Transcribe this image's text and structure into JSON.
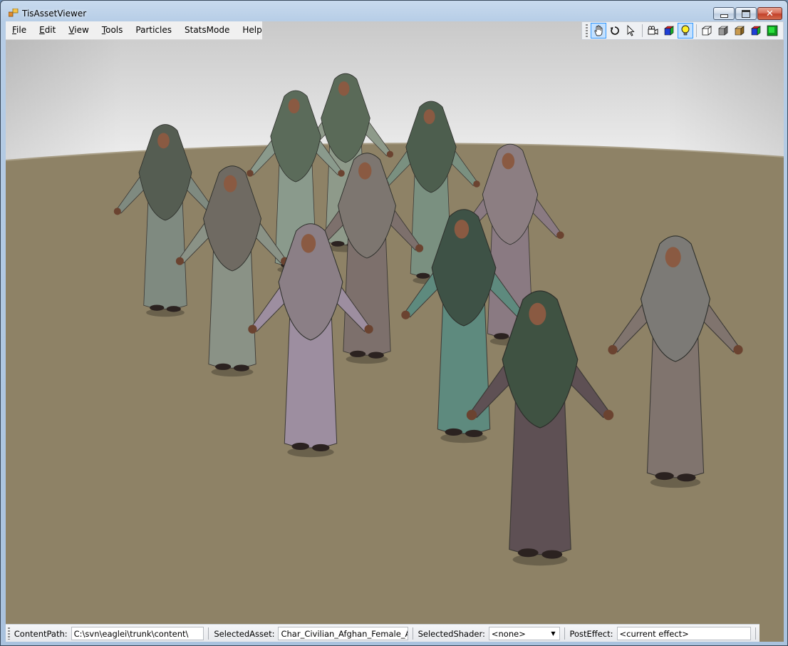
{
  "window": {
    "title": "TisAssetViewer"
  },
  "menu": {
    "items": [
      {
        "ul": "F",
        "rest": "ile"
      },
      {
        "ul": "E",
        "rest": "dit"
      },
      {
        "ul": "V",
        "rest": "iew"
      },
      {
        "ul": "T",
        "rest": "ools"
      },
      {
        "ul": "",
        "rest": "Particles"
      },
      {
        "ul": "",
        "rest": "StatsMode"
      },
      {
        "ul": "",
        "rest": "Help"
      }
    ]
  },
  "toolbar": {
    "buttons": [
      "hand-pan-icon",
      "rotate-icon",
      "select-arrow-icon",
      "camera-icon",
      "rgb-cube-icon",
      "light-bulb-icon",
      "wire-cube-icon",
      "gray-cube-icon",
      "tan-cube-icon",
      "color-cube-icon",
      "green-square-icon"
    ],
    "active": [
      "hand-pan-icon",
      "light-bulb-icon"
    ]
  },
  "statusbar": {
    "content_path_label": "ContentPath:",
    "content_path_value": "C:\\svn\\eaglei\\trunk\\content\\",
    "selected_asset_label": "SelectedAsset:",
    "selected_asset_value": "Char_Civilian_Afghan_Female_Adult.",
    "selected_shader_label": "SelectedShader:",
    "selected_shader_value": "<none>",
    "post_effect_label": "PostEffect:",
    "post_effect_value": "<current effect>"
  },
  "scene": {
    "colors": {
      "sky": "#d4d4d4",
      "ground": "#8e8266"
    },
    "figures": [
      {
        "id": "f1",
        "scarf": "#5a6a58",
        "dress": "#8e9a8a"
      },
      {
        "id": "f2",
        "scarf": "#4d5e4e",
        "dress": "#7a9080"
      },
      {
        "id": "f3",
        "scarf": "#5b6b5a",
        "dress": "#8a9a8c"
      },
      {
        "id": "f4",
        "scarf": "#555d52",
        "dress": "#7f8a80"
      },
      {
        "id": "f5",
        "scarf": "#7d7670",
        "dress": "#7d706c"
      },
      {
        "id": "f6",
        "scarf": "#6f6a62",
        "dress": "#8a9286"
      },
      {
        "id": "f7",
        "scarf": "#8c7e82",
        "dress": "#8a7a82"
      },
      {
        "id": "f8",
        "scarf": "#8b7f86",
        "dress": "#9d8ea0"
      },
      {
        "id": "f9",
        "scarf": "#3e5246",
        "dress": "#5e8a7e"
      },
      {
        "id": "f10",
        "scarf": "#7c7a76",
        "dress": "#80746e"
      },
      {
        "id": "f11",
        "scarf": "#3f5242",
        "dress": "#5e5054"
      }
    ]
  }
}
